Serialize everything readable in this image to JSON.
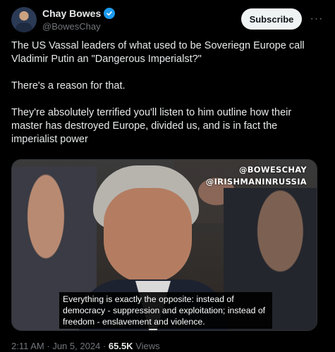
{
  "author": {
    "name": "Chay Bowes",
    "handle": "@BowesChay",
    "verified": true,
    "avatar_icon": "profile-photo"
  },
  "actions": {
    "subscribe_label": "Subscribe",
    "more_icon": "more-horizontal-icon",
    "more_glyph": "···"
  },
  "tweet": {
    "paragraphs": [
      "The US Vassal leaders of what used to be Soveriegn Europe call Vladimir Putin an \"Dangerous Imperialst?\"",
      "There's a reason for that.",
      "They're absolutely terrified you'll listen to him outline how their master has destroyed Europe, divided us, and is in fact the imperialist power"
    ]
  },
  "media": {
    "watermark_line1": "@BOWESCHAY",
    "watermark_line2": "@IRISHMANINRUSSIA",
    "caption": "Everything is exactly the opposite: instead of democracy - suppression and exploitation; instead of freedom - enslavement and violence."
  },
  "meta": {
    "time": "2:11 AM",
    "separator": "·",
    "date": "Jun 5, 2024",
    "views_count": "65.5K",
    "views_label": "Views"
  },
  "colors": {
    "background": "#000000",
    "text": "#e7e9ea",
    "muted": "#71767b",
    "verified": "#1d9bf0",
    "subscribe_bg": "#eff3f4"
  }
}
